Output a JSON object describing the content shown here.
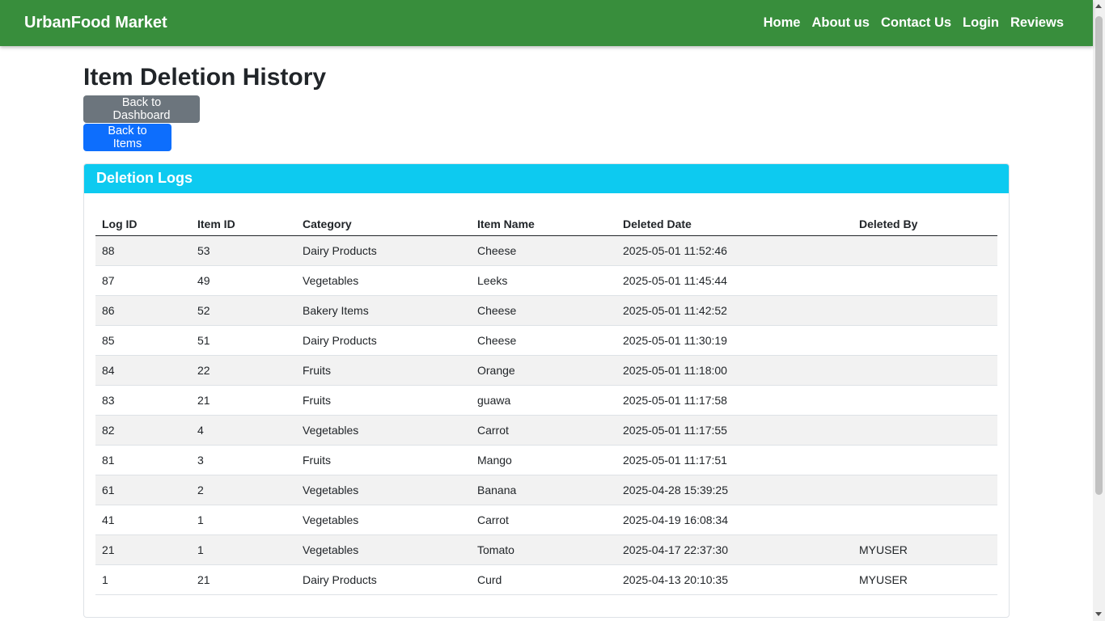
{
  "navbar": {
    "brand": "UrbanFood Market",
    "links": [
      "Home",
      "About us",
      "Contact Us",
      "Login",
      "Reviews"
    ],
    "color": "#388e3c"
  },
  "page": {
    "title": "Item Deletion History",
    "back_dashboard": "Back to Dashboard",
    "back_items": "Back to Items"
  },
  "card": {
    "title": "Deletion Logs",
    "header_color": "#0dcaf0"
  },
  "table": {
    "columns": [
      "Log ID",
      "Item ID",
      "Category",
      "Item Name",
      "Deleted Date",
      "Deleted By"
    ],
    "rows": [
      [
        "88",
        "53",
        "Dairy Products",
        "Cheese",
        "2025-05-01 11:52:46",
        ""
      ],
      [
        "87",
        "49",
        "Vegetables",
        "Leeks",
        "2025-05-01 11:45:44",
        ""
      ],
      [
        "86",
        "52",
        "Bakery Items",
        "Cheese",
        "2025-05-01 11:42:52",
        ""
      ],
      [
        "85",
        "51",
        "Dairy Products",
        "Cheese",
        "2025-05-01 11:30:19",
        ""
      ],
      [
        "84",
        "22",
        "Fruits",
        "Orange",
        "2025-05-01 11:18:00",
        ""
      ],
      [
        "83",
        "21",
        "Fruits",
        "guawa",
        "2025-05-01 11:17:58",
        ""
      ],
      [
        "82",
        "4",
        "Vegetables",
        "Carrot",
        "2025-05-01 11:17:55",
        ""
      ],
      [
        "81",
        "3",
        "Fruits",
        "Mango",
        "2025-05-01 11:17:51",
        ""
      ],
      [
        "61",
        "2",
        "Vegetables",
        "Banana",
        "2025-04-28 15:39:25",
        ""
      ],
      [
        "41",
        "1",
        "Vegetables",
        "Carrot",
        "2025-04-19 16:08:34",
        ""
      ],
      [
        "21",
        "1",
        "Vegetables",
        "Tomato",
        "2025-04-17 22:37:30",
        "MYUSER"
      ],
      [
        "1",
        "21",
        "Dairy Products",
        "Curd",
        "2025-04-13 20:10:35",
        "MYUSER"
      ]
    ]
  }
}
